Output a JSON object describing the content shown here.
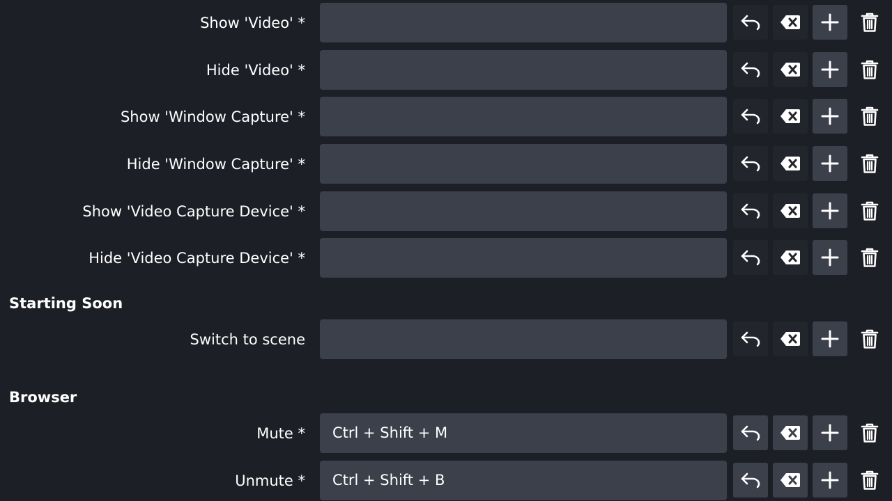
{
  "rows_top": [
    {
      "label": "Show 'Video' *",
      "value": ""
    },
    {
      "label": "Hide 'Video' *",
      "value": ""
    },
    {
      "label": "Show 'Window Capture' *",
      "value": ""
    },
    {
      "label": "Hide 'Window Capture' *",
      "value": ""
    },
    {
      "label": "Show 'Video Capture Device' *",
      "value": ""
    },
    {
      "label": "Hide 'Video Capture Device' *",
      "value": ""
    }
  ],
  "section_starting_soon": {
    "title": "Starting Soon",
    "rows": [
      {
        "label": "Switch to scene",
        "value": ""
      }
    ]
  },
  "section_browser": {
    "title": "Browser",
    "rows": [
      {
        "label": "Mute *",
        "value": "Ctrl + Shift + M"
      },
      {
        "label": "Unmute *",
        "value": "Ctrl + Shift + B"
      }
    ]
  },
  "icons": {
    "revert": "revert-icon",
    "clear": "clear-icon",
    "add": "plus-icon",
    "remove": "trash-icon"
  },
  "colors": {
    "background": "#1d1f26",
    "field": "#3c404b",
    "button_dim": "#23252d",
    "text": "#ffffff"
  }
}
